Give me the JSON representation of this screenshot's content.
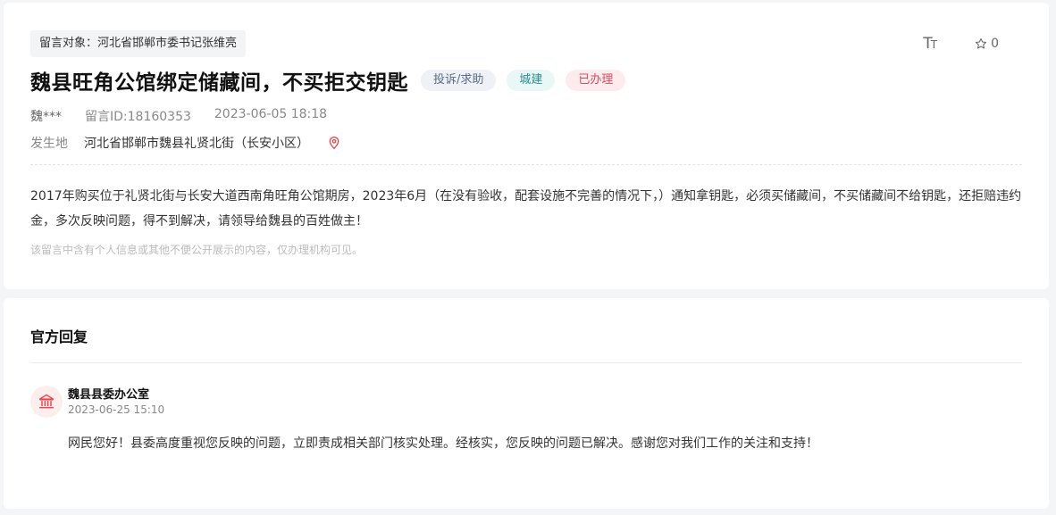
{
  "message": {
    "target": "留言对象：河北省邯郸市委书记张维亮",
    "title": "魏县旺角公馆绑定储藏间，不买拒交钥匙",
    "tags": {
      "type": "投诉/求助",
      "field": "城建",
      "status": "已办理"
    },
    "author": "魏***",
    "message_id": "留言ID:18160353",
    "datetime": "2023-06-05 18:18",
    "location_label": "发生地",
    "location": "河北省邯郸市魏县礼贤北街（长安小区）",
    "content": "2017年购买位于礼贤北街与长安大道西南角旺角公馆期房，2023年6月（在没有验收，配套设施不完善的情况下，）通知拿钥匙，必须买储藏间，不买储藏间不给钥匙，还拒赔违约金，多次反映问题，得不到解决，请领导给魏县的百姓做主！",
    "notice": "该留言中含有个人信息或其他不便公开展示的内容，仅办理机构可见。",
    "favorite_count": "0"
  },
  "toolbar": {
    "font_big": "T",
    "font_small": "T"
  },
  "reply": {
    "section_title": "官方回复",
    "org_name": "魏县县委办公室",
    "date": "2023-06-25 15:10",
    "content": "网民您好！县委高度重视您反映的问题，立即责成相关部门核实处理。经核实，您反映的问题已解决。感谢您对我们工作的关注和支持！"
  },
  "icons": {
    "star": "star-outline-icon",
    "location": "location-pin-icon",
    "org": "government-building-icon"
  },
  "colors": {
    "accent_red": "#e5484d",
    "status_red": "#d94b5c",
    "field_teal": "#2c8e8e"
  }
}
